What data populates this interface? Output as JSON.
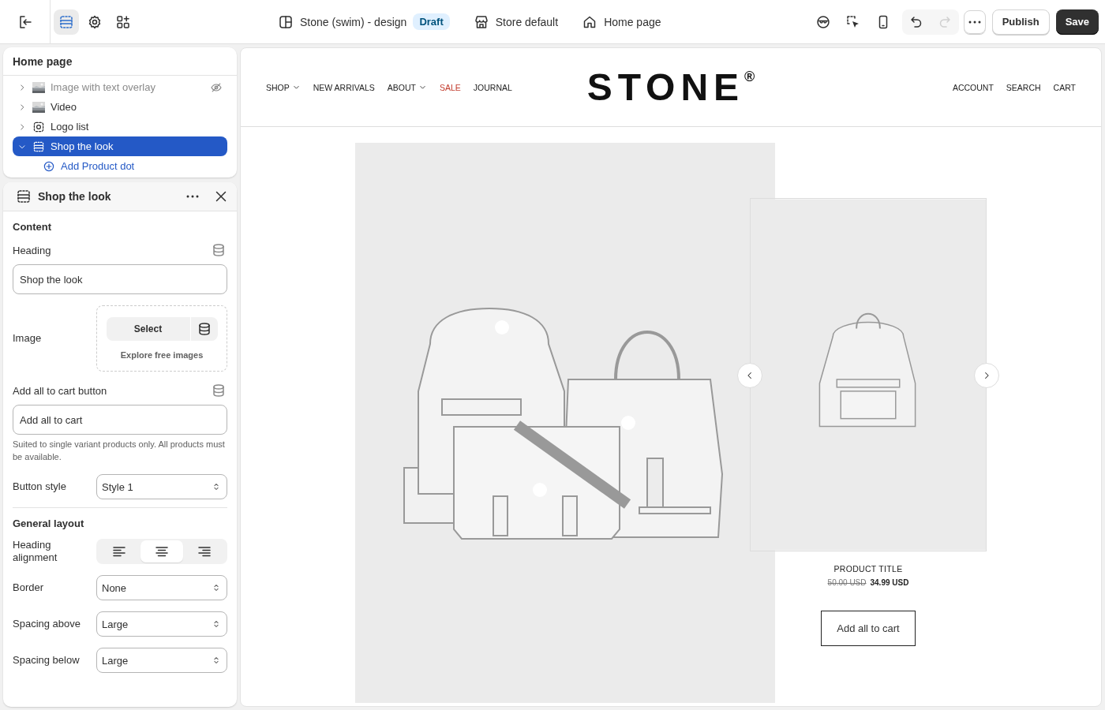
{
  "topbar": {
    "tools": [
      {
        "kind": "sections",
        "selected": true
      },
      {
        "kind": "settings",
        "selected": false
      },
      {
        "kind": "apps",
        "selected": false
      }
    ],
    "theme": "Stone (swim) - design",
    "badge": "Draft",
    "store": "Store default",
    "page": "Home page",
    "actions": [
      {
        "kind": "inspector"
      },
      {
        "kind": "select-element"
      },
      {
        "kind": "mobile"
      }
    ],
    "history": [
      {
        "kind": "undo",
        "disabled": false
      },
      {
        "kind": "redo",
        "disabled": true
      }
    ],
    "publish": "Publish",
    "save": "Save"
  },
  "sections_panel": {
    "title": "Home page",
    "items": [
      {
        "label": "Image with text overlay",
        "kind": "picture",
        "hidden": true,
        "expanded": false,
        "selected": false
      },
      {
        "label": "Video",
        "kind": "picture",
        "hidden": false,
        "expanded": false,
        "selected": false
      },
      {
        "label": "Logo list",
        "kind": "logo",
        "hidden": false,
        "expanded": false,
        "selected": false
      },
      {
        "label": "Shop the look",
        "kind": "section",
        "hidden": false,
        "expanded": true,
        "selected": true,
        "children": [
          {
            "label": "Add Product dot",
            "kind": "add"
          }
        ]
      }
    ]
  },
  "settings": {
    "title": "Shop the look",
    "groups": [
      {
        "heading": "Content",
        "fields": [
          {
            "kind": "text",
            "label": "Heading",
            "value": "Shop the look",
            "dynamic": true
          },
          {
            "label": "Image",
            "button": "Select",
            "link": "Explore free images"
          },
          {
            "kind": "text",
            "label": "Add all to cart button",
            "value": "Add all to cart",
            "dynamic": true,
            "help": "Suited to single variant products only. All products must be available."
          },
          {
            "kind": "select",
            "label": "Button style",
            "value": "Style 1"
          }
        ]
      },
      {
        "heading": "General layout",
        "fields": [
          {
            "kind": "segmented",
            "label": "Heading alignment",
            "options": [
              {
                "kind": "left",
                "selected": false
              },
              {
                "kind": "center",
                "selected": true
              },
              {
                "kind": "right",
                "selected": false
              }
            ]
          },
          {
            "kind": "select",
            "label": "Border",
            "value": "None"
          },
          {
            "kind": "select",
            "label": "Spacing above",
            "value": "Large"
          },
          {
            "kind": "select",
            "label": "Spacing below",
            "value": "Large"
          }
        ]
      }
    ]
  },
  "preview": {
    "nav_left": [
      {
        "label": "SHOP",
        "dropdown": true,
        "highlight": false
      },
      {
        "label": "NEW ARRIVALS",
        "dropdown": false,
        "highlight": false
      },
      {
        "label": "ABOUT",
        "dropdown": true,
        "highlight": false
      },
      {
        "label": "SALE",
        "dropdown": false,
        "highlight": true
      },
      {
        "label": "JOURNAL",
        "dropdown": false,
        "highlight": false
      }
    ],
    "logo": "STONE$^{®}$",
    "nav_right": [
      "ACCOUNT",
      "SEARCH",
      "CART"
    ],
    "look": {
      "kind": "picture"
    },
    "product": {
      "title": "PRODUCT TITLE",
      "compare_price": "50.00 USD",
      "price": "34.99 USD",
      "button": "Add all to cart"
    }
  }
}
